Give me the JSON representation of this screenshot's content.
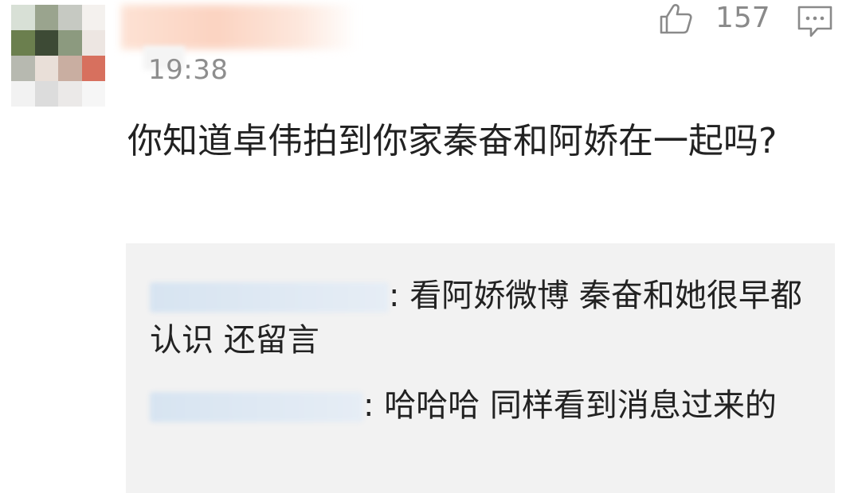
{
  "comment": {
    "timestamp": "19:38",
    "like_count": "157",
    "text": "你知道卓伟拍到你家秦奋和阿娇在一起吗?"
  },
  "replies": [
    {
      "text": ": 看阿娇微博 秦奋和她很早都认识 还留言"
    },
    {
      "text": ": 哈哈哈 同样看到消息过来的"
    }
  ],
  "icons": {
    "like": "thumbs-up-icon",
    "comment": "comment-bubble-icon"
  },
  "colors": {
    "meta_text": "#8e8e8e",
    "body_text": "#222222",
    "reply_bg": "#f2f2f2"
  }
}
